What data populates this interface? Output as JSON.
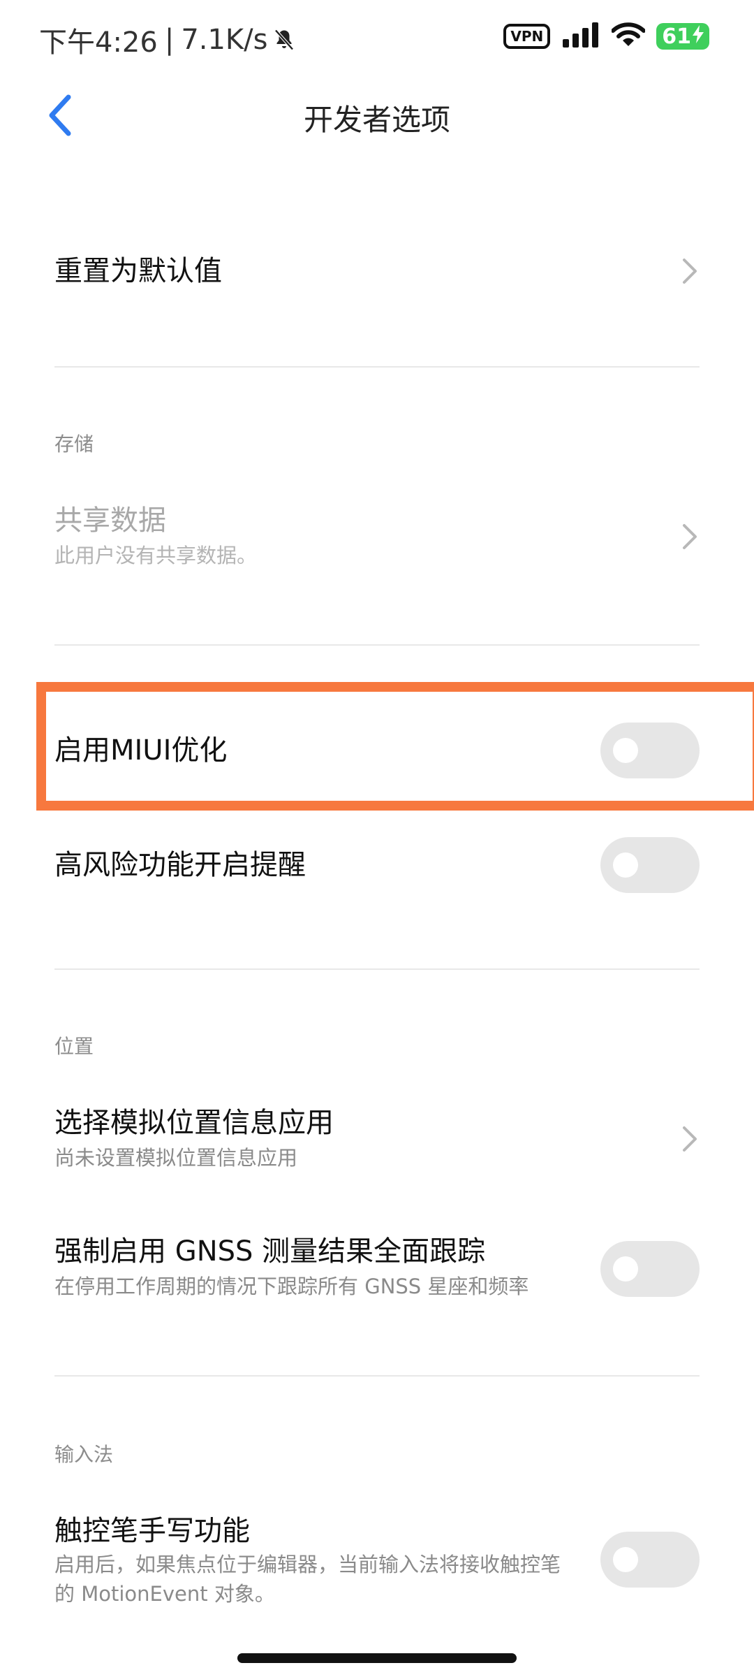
{
  "status_bar": {
    "time": "下午4:26",
    "separator": "|",
    "net_speed": "7.1K/s",
    "vpn": "VPN",
    "battery": "61"
  },
  "header": {
    "title": "开发者选项"
  },
  "items": {
    "reset_default": {
      "title": "重置为默认值"
    },
    "storage_section": "存储",
    "shared_data": {
      "title": "共享数据",
      "subtitle": "此用户没有共享数据。"
    },
    "miui_optimization": {
      "title": "启用MIUI优化",
      "enabled": false
    },
    "high_risk_reminder": {
      "title": "高风险功能开启提醒",
      "enabled": false
    },
    "location_section": "位置",
    "mock_location": {
      "title": "选择模拟位置信息应用",
      "subtitle": "尚未设置模拟位置信息应用"
    },
    "gnss": {
      "title": "强制启用 GNSS 测量结果全面跟踪",
      "subtitle": "在停用工作周期的情况下跟踪所有 GNSS 星座和频率",
      "enabled": false
    },
    "input_section": "输入法",
    "stylus": {
      "title": "触控笔手写功能",
      "subtitle_line1": "启用后，如果焦点位于编辑器，当前输入法将接收触控笔",
      "subtitle_line2": "的 MotionEvent 对象。",
      "enabled": false
    }
  },
  "colors": {
    "accent": "#2f7bf0",
    "highlight": "#f7783e",
    "toggle_off": "#e6e6e6"
  }
}
